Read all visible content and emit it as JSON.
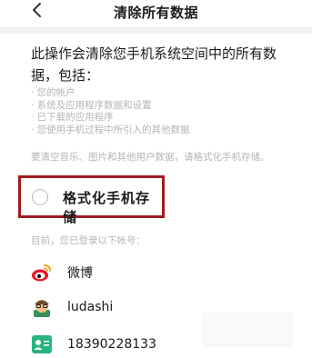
{
  "header": {
    "title": "清除所有数据",
    "back_icon": "chevron-left-icon"
  },
  "main": {
    "description": "此操作会清除您手机系统空间中的所有数据，包括：",
    "items": [
      "· 您的帐户",
      "· 系统及应用程序数据和设置",
      "· 已下载的应用程序",
      "· 您使用手机过程中所引入的其他数据"
    ],
    "note": "要清空音乐、图片和其他用户数据，请格式化手机存储。",
    "format_option": {
      "label": "格式化手机存储",
      "checked": false,
      "highlight_color": "#9b1b1f"
    }
  },
  "accounts": {
    "header": "目前，您已登录以下帐号：",
    "items": [
      {
        "icon": "weibo-icon",
        "name": "微博"
      },
      {
        "icon": "ludashi-avatar-icon",
        "name": "ludashi"
      },
      {
        "icon": "contact-card-icon",
        "name": "18390228133"
      }
    ]
  },
  "colors": {
    "background": "#ffffff",
    "text_primary": "#1a1a1a",
    "text_secondary": "#b5b5b5",
    "divider": "#f2f2f2",
    "weibo_red": "#e6162d",
    "weibo_orange": "#f5a623",
    "card_green": "#26b47f"
  }
}
